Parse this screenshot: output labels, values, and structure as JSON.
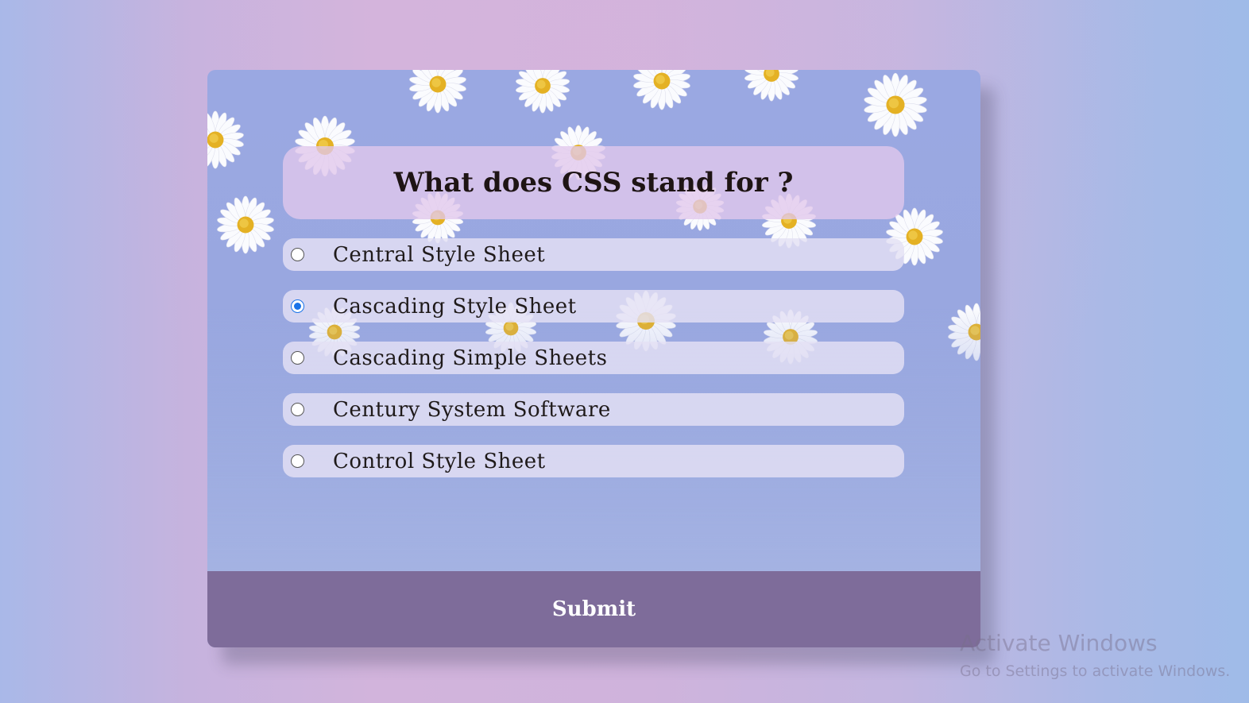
{
  "quiz": {
    "question": "What does CSS stand for ?",
    "options": [
      {
        "label": "Central Style Sheet",
        "selected": false
      },
      {
        "label": "Cascading Style Sheet",
        "selected": true
      },
      {
        "label": "Cascading Simple Sheets",
        "selected": false
      },
      {
        "label": "Century System Software",
        "selected": false
      },
      {
        "label": "Control Style Sheet",
        "selected": false
      }
    ],
    "submit_label": "Submit"
  },
  "watermark": {
    "title": "Activate Windows",
    "subtitle": "Go to Settings to activate Windows."
  },
  "colors": {
    "submit_bar": "#7e6c9a",
    "radio_checked": "#1a73e8",
    "card_background": "#9aa8e2"
  },
  "icons": {
    "decoration": "daisy-flower-icon"
  }
}
